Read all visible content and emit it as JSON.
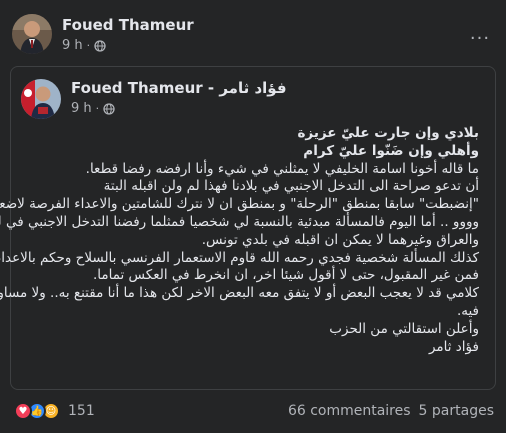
{
  "post": {
    "author": "Foued Thameur",
    "time": "9 h",
    "privacy_icon": "globe-icon",
    "more_icon": "ellipsis-icon"
  },
  "shared": {
    "author": "Foued Thameur - فؤاد ثامر",
    "time": "9 h",
    "privacy_icon": "globe-icon",
    "lines": [
      "بلادي وإن جارت عليّ عزيزة",
      "وأهلي وإن ضَنّوا عليّ كرام",
      "ما قاله أخونا اسامة الخليفي لا يمثلني في شيء وأنا ارفضه رفضا قطعا.",
      "أن تدعو صراحة الى التدخل الاجنبي في بلادنا فهذا لم ولن اقبله البتة",
      "\"إنضبطت\" سابقا بمنطق \"الرحلة\" و بمنطق ان لا نترك للشامتين والاعداء الفرصة لاضعافنا",
      "وووو .. أما اليوم فالمسألة مبدئية بالنسبة لي شخصيا فمثلما رفضنا التدخل الاجنبي في ليبيا",
      "والعراق وغيرهما لا يمكن ان اقبله في بلدي تونس.",
      "كذلك المسألة شخصية فجدي رحمه الله قاوم الاستعمار الفرنسي بالسلاح وحكم بالاعدام،",
      "فمن غير المقبول، حتى لا أقول شيئا اخر، ان انخرط في العكس تماما.",
      "كلامي قد لا يعجب البعض أو لا يتفق معه البعض الاخر لكن هذا ما أنا مقتنع به.. ولا مساومة",
      "فيه.",
      "وأعلن استقالتي من الحزب",
      "فؤاد ثامر"
    ]
  },
  "footer": {
    "reaction_icons": [
      "like-icon",
      "love-icon",
      "care-icon"
    ],
    "colors": {
      "like": "#2e89ff",
      "love": "#f33e58",
      "care": "#f7b125"
    },
    "reaction_count": "151",
    "comments": "66 commentaires",
    "shares": "5 partages"
  }
}
